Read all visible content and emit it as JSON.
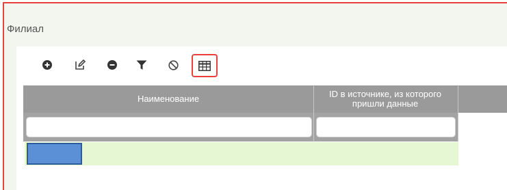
{
  "section": {
    "title": "Филиал"
  },
  "toolbar": {
    "buttons": [
      {
        "icon": "add-circle-icon"
      },
      {
        "icon": "edit-icon"
      },
      {
        "icon": "remove-circle-icon"
      },
      {
        "icon": "filter-icon"
      },
      {
        "icon": "block-icon"
      },
      {
        "icon": "table-icon",
        "highlighted": true
      }
    ]
  },
  "grid": {
    "columns": [
      {
        "label": "Наименование"
      },
      {
        "label": "ID в источнике, из которого пришли данные"
      }
    ],
    "filters": [
      "",
      ""
    ],
    "rows": [
      [
        "",
        ""
      ]
    ]
  },
  "colors": {
    "header_bg": "#9a9a9a",
    "row_bg": "#e6f8d3",
    "selection": "#5b8fd6",
    "highlight_border": "#e8403c"
  }
}
